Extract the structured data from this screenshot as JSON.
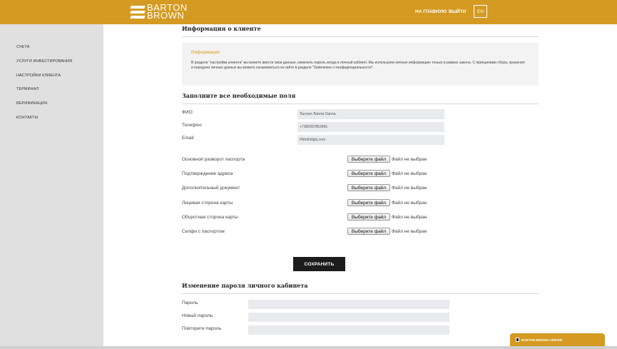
{
  "brand": {
    "line1": "BARTON",
    "line2": "BROWN",
    "color": "#d49a22"
  },
  "header": {
    "nav_home": "НА ГЛАВНУЮ",
    "nav_logout": "ВЫЙТИ",
    "lang": "EN"
  },
  "sidebar": {
    "items": [
      {
        "label": "СЧЕТА"
      },
      {
        "label": "УСЛУГИ ИНВЕСТИРОВАНИЯ"
      },
      {
        "label": "НАСТРОЙКИ КЛИЕНТА"
      },
      {
        "label": "ТЕРМИНАЛ"
      },
      {
        "label": "ВЕРИФИКАЦИЯ"
      },
      {
        "label": "КОНТАКТЫ"
      }
    ]
  },
  "client_info": {
    "title": "Информация о клиенте",
    "box_heading": "Информация",
    "box_text": "В разделе \"настройки клиента\" вы можете ввести свои данные, изменить пароль входа в личный кабинет. Мы используем личную информацию только в рамках закона. С принципами сбора, хранения и передачи личных данных вы можете ознакомиться на сайте в разделе \"Заявление о конфиденциальности\"."
  },
  "required_fields": {
    "title": "Заполните все необходимые поля",
    "fio_label": "ФИО:",
    "fio_value": "Лаллал Липлм Оапла",
    "phone_label": "Телефон:",
    "phone_value": "+7380957853456",
    "email_label": "Email:",
    "email_value": "Hhhdhhlghj.com"
  },
  "documents": {
    "button_label": "Выберите файл",
    "status": "Файл не выбран",
    "items": [
      {
        "label": "Основной разворот паспорта"
      },
      {
        "label": "Подтверждение адреса"
      },
      {
        "label": "Дополнительный документ"
      },
      {
        "label": "Лицевая сторона карты"
      },
      {
        "label": "Оборотная сторона карты"
      },
      {
        "label": "Селфи с паспортом"
      }
    ]
  },
  "save_button": "СОХРАНИТЬ",
  "password_change": {
    "title": "Изменение пароля личного кабинета",
    "password_label": "Пароль",
    "new_password_label": "Новый пароль",
    "repeat_password_label": "Повторите пароль"
  },
  "chat_widget": {
    "label": "BARTON BROWN LIMITED",
    "icon": "chat-icon"
  }
}
